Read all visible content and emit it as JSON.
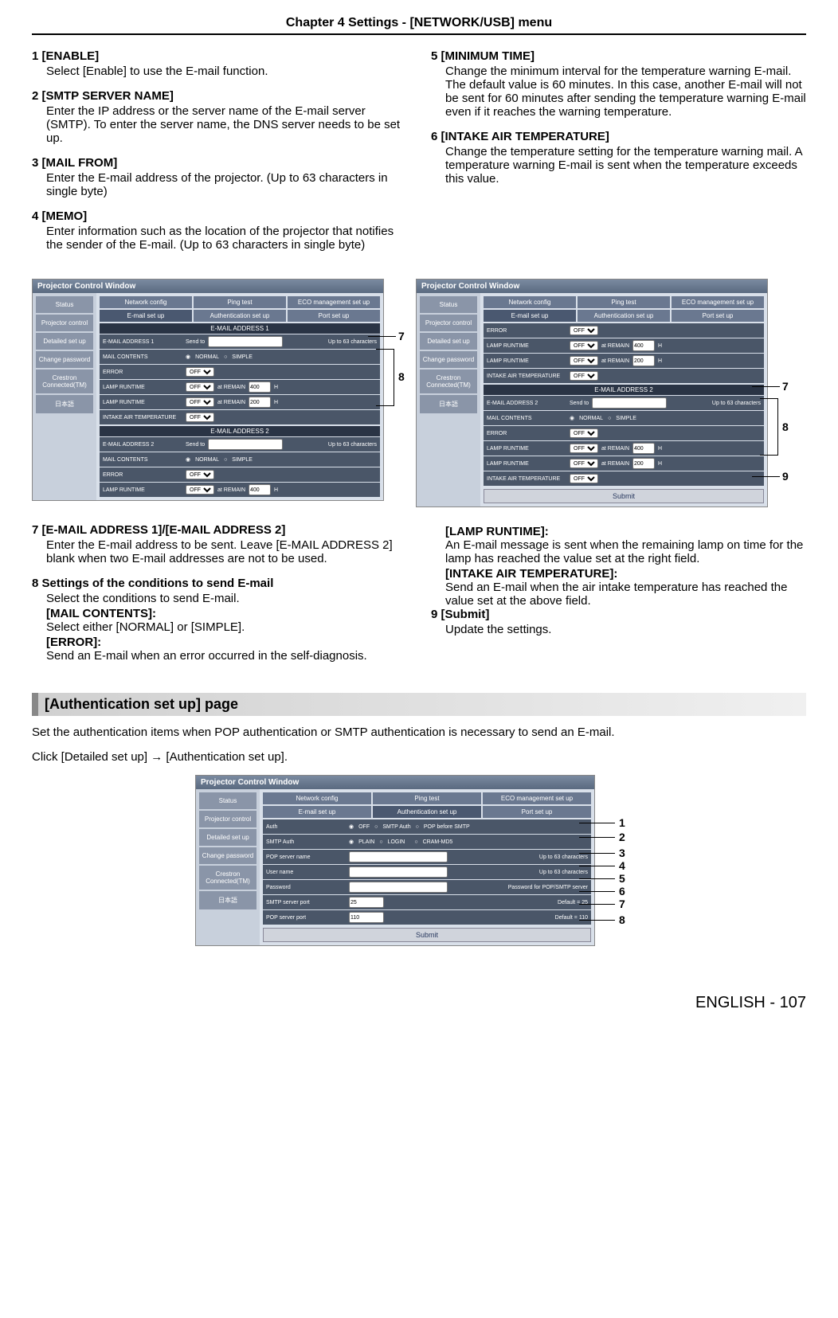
{
  "chapter": "Chapter 4   Settings - [NETWORK/USB] menu",
  "items_left": [
    {
      "num": "1",
      "title": "[ENABLE]",
      "desc": "Select [Enable] to use the E-mail function."
    },
    {
      "num": "2",
      "title": "[SMTP SERVER NAME]",
      "desc": "Enter the IP address or the server name of the E-mail server (SMTP). To enter the server name, the DNS server needs to be set up."
    },
    {
      "num": "3",
      "title": "[MAIL FROM]",
      "desc": "Enter the E-mail address of the projector. (Up to 63 characters in single byte)"
    },
    {
      "num": "4",
      "title": "[MEMO]",
      "desc": "Enter information such as the location of the projector that notifies the sender of the E-mail. (Up to 63 characters in single byte)"
    }
  ],
  "items_right": [
    {
      "num": "5",
      "title": "[MINIMUM TIME]",
      "desc": "Change the minimum interval for the temperature warning E-mail. The default value is 60 minutes. In this case, another E-mail will not be sent for 60 minutes after sending the temperature warning E-mail even if it reaches the warning temperature."
    },
    {
      "num": "6",
      "title": "[INTAKE AIR TEMPERATURE]",
      "desc": "Change the temperature setting for the temperature warning mail. A temperature warning E-mail is sent when the temperature exceeds this value."
    }
  ],
  "pcw_title": "Projector Control Window",
  "sidebar": [
    "Status",
    "Projector control",
    "Detailed set up",
    "Change password",
    "Crestron Connected(TM)",
    "日本語"
  ],
  "tabs1": [
    "Network config",
    "Ping test",
    "ECO management set up"
  ],
  "tabs2": [
    "E-mail set up",
    "Authentication set up",
    "Port set up"
  ],
  "hdr_addr1": "E-MAIL ADDRESS 1",
  "hdr_addr2": "E-MAIL ADDRESS 2",
  "lab_email_addr1": "E-MAIL ADDRESS 1",
  "lab_email_addr2": "E-MAIL ADDRESS 2",
  "lab_sendto": "Send to",
  "lab_upto63": "Up to 63 characters",
  "lab_mailcontents": "MAIL CONTENTS",
  "lab_normal": "NORMAL",
  "lab_simple": "SIMPLE",
  "lab_error": "ERROR",
  "lab_off": "OFF",
  "lab_lampruntime": "LAMP RUNTIME",
  "lab_atremain": "at REMAIN",
  "val_400": "400",
  "val_200": "200",
  "lab_h": "H",
  "lab_intake": "INTAKE AIR TEMPERATURE",
  "lab_submit": "Submit",
  "callout_7": "7",
  "callout_8": "8",
  "callout_9": "9",
  "lower_left": [
    {
      "num": "7",
      "title": "[E-MAIL ADDRESS 1]/[E-MAIL ADDRESS 2]",
      "desc": "Enter the E-mail address to be sent. Leave [E-MAIL ADDRESS 2] blank when two E-mail addresses are not to be used."
    },
    {
      "num": "8",
      "title": "Settings of the conditions to send E-mail",
      "desc": "Select the conditions to send E-mail.",
      "subs": [
        {
          "t": "[MAIL CONTENTS]:",
          "d": "Select either [NORMAL] or [SIMPLE]."
        },
        {
          "t": "[ERROR]:",
          "d": "Send an E-mail when an error occurred in the self-diagnosis."
        }
      ]
    }
  ],
  "lower_right": [
    {
      "t": "[LAMP RUNTIME]:",
      "d": "An E-mail message is sent when the remaining lamp on time for the lamp has reached the value set at the right field."
    },
    {
      "t": "[INTAKE AIR TEMPERATURE]:",
      "d": "Send an E-mail when the air intake temperature has reached the value set at the above field."
    }
  ],
  "item9": {
    "num": "9",
    "title": "[Submit]",
    "desc": "Update the settings."
  },
  "auth_header": "[Authentication set up] page",
  "auth_intro1": "Set the authentication items when POP authentication or SMTP authentication is necessary to send an E-mail.",
  "auth_intro2": "Click [Detailed set up] → [Authentication set up].",
  "auth_rows": {
    "auth": "Auth",
    "off": "OFF",
    "smtpauth": "SMTP Auth",
    "popbefore": "POP before SMTP",
    "smtpauthlab": "SMTP Auth",
    "plain": "PLAIN",
    "login": "LOGIN",
    "crammd5": "CRAM-MD5",
    "popserver": "POP server name",
    "upto63": "Up to 63 characters",
    "username": "User name",
    "password": "Password",
    "pwhint": "Password for POP/SMTP server",
    "smtpport": "SMTP server port",
    "smtpportval": "25",
    "smtpdef": "Default = 25",
    "popport": "POP server port",
    "popportval": "110",
    "popdef": "Default = 110"
  },
  "auth_callouts": [
    "1",
    "2",
    "3",
    "4",
    "5",
    "6",
    "7",
    "8"
  ],
  "footer": "ENGLISH - 107"
}
